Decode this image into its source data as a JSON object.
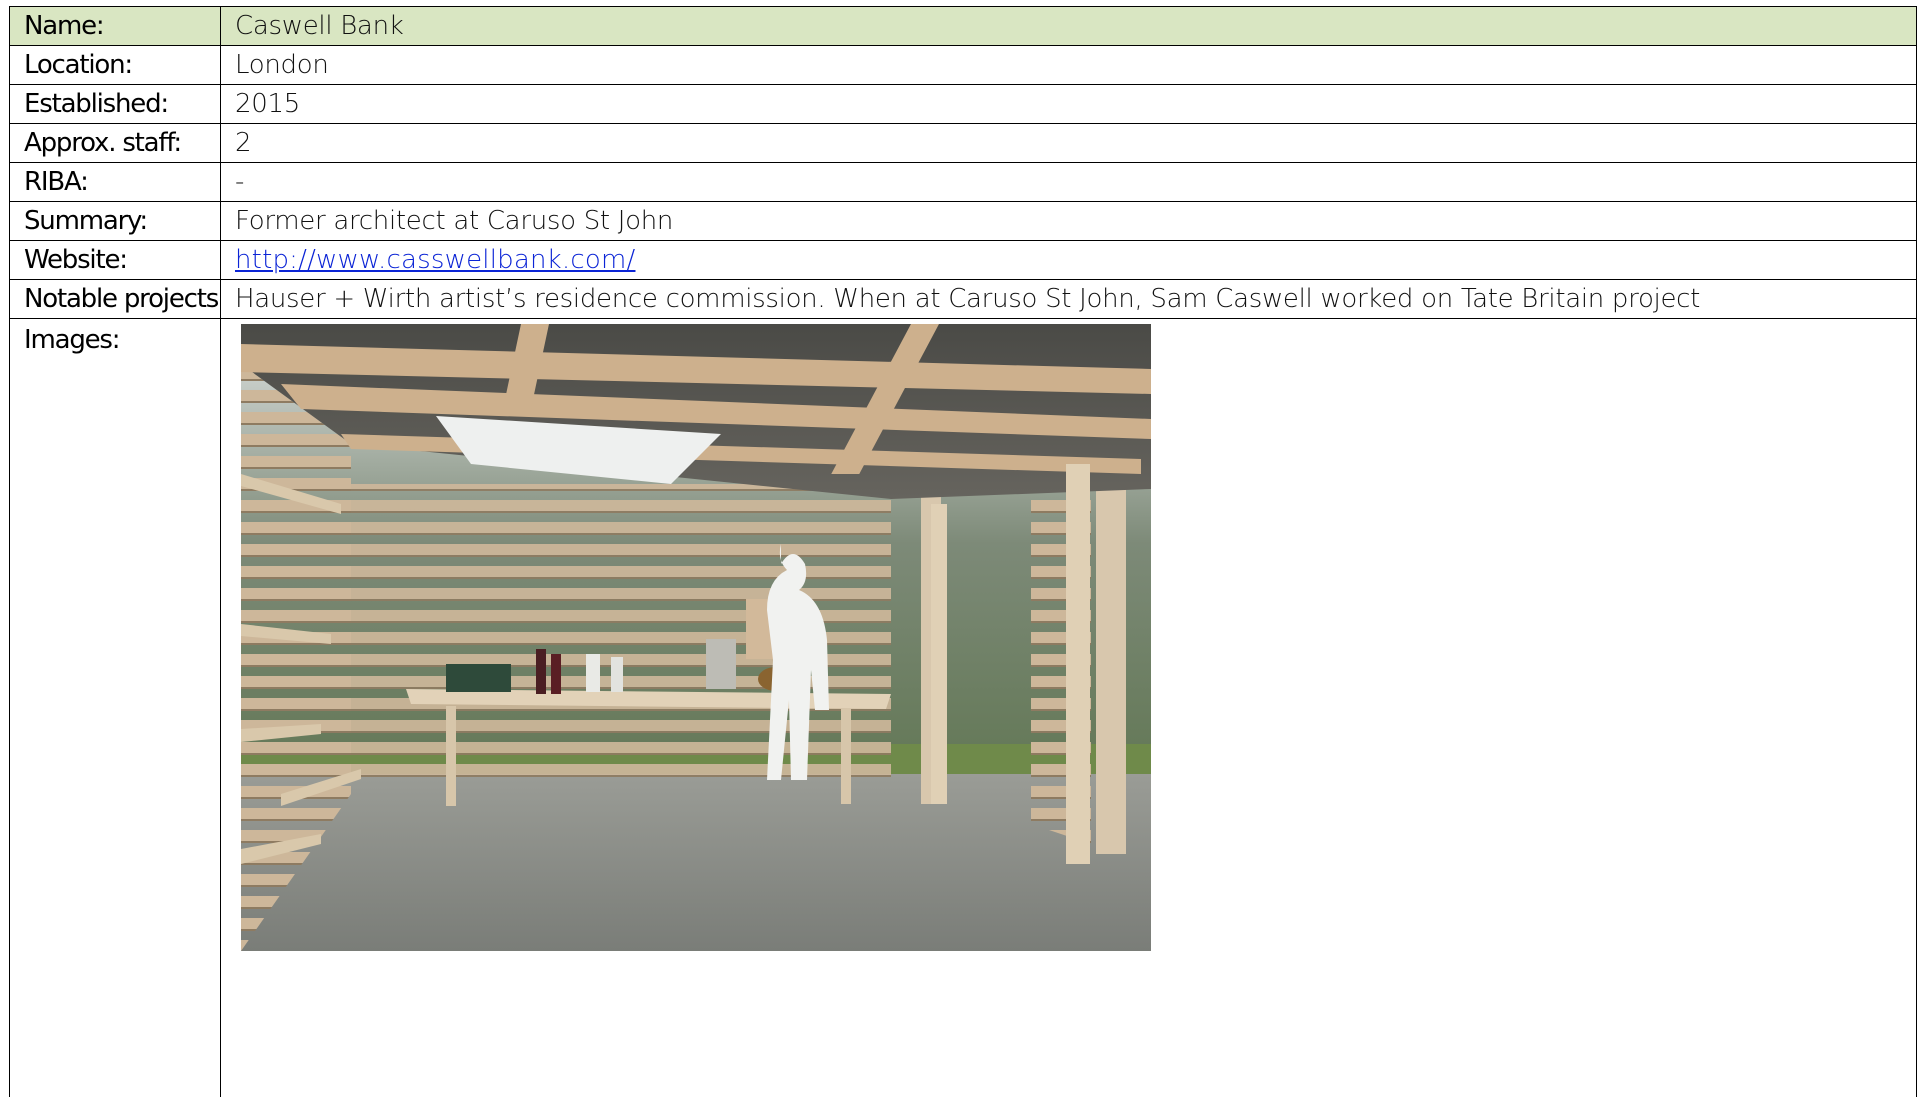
{
  "profile": {
    "name_label": "Name:",
    "name_value": "Caswell Bank",
    "location_label": "Location:",
    "location_value": "London",
    "established_label": "Established:",
    "established_value": "2015",
    "staff_label": "Approx. staff:",
    "staff_value": "2",
    "riba_label": "RIBA:",
    "riba_value": "-",
    "summary_label": "Summary:",
    "summary_value": "Former architect at Caruso St John",
    "website_label": "Website:",
    "website_value": "http://www.casswellbank.com/",
    "projects_label": "Notable projects:",
    "projects_value": "Hauser + Wirth artist’s residence commission. When at Caruso St John, Sam Caswell worked on Tate Britain project",
    "images_label": "Images:"
  },
  "colors": {
    "header_row_bg": "#d9e6c2",
    "link": "#0b24d6",
    "border": "#000000"
  }
}
